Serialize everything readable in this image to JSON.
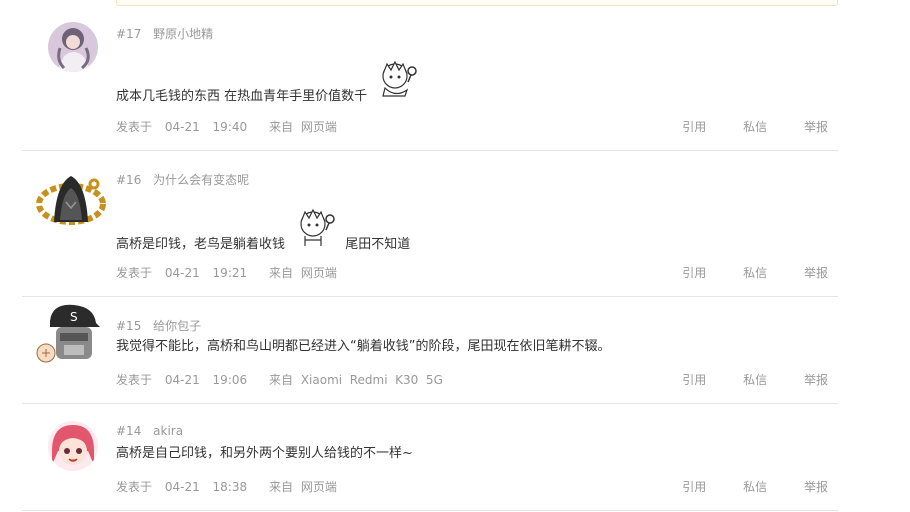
{
  "posts": [
    {
      "floor": "#17",
      "username": "野原小地精",
      "content_before": "成本几毛钱的东西  在热血青年手里价值数千",
      "content_after": "",
      "has_emote": true,
      "posted_label": "发表于",
      "date": "04-21",
      "time": "19:40",
      "source_label": "来自",
      "source": "网页端",
      "actions": [
        "引用",
        "私信",
        "举报"
      ],
      "avatar_icon": "anime-girl-avatar"
    },
    {
      "floor": "#16",
      "username": "为什么会有变态呢",
      "content_before": "高桥是印钱，老鸟是躺着收钱",
      "content_after": "尾田不知道",
      "has_emote": true,
      "posted_label": "发表于",
      "date": "04-21",
      "time": "19:21",
      "source_label": "来自",
      "source": "网页端",
      "actions": [
        "引用",
        "私信",
        "举报"
      ],
      "avatar_icon": "hooded-assassin-avatar"
    },
    {
      "floor": "#15",
      "username": "给你包子",
      "content_before": "我觉得不能比，高桥和鸟山明都已经进入“躺着收钱”的阶段，尾田现在依旧笔耕不辍。",
      "content_after": "",
      "has_emote": false,
      "posted_label": "发表于",
      "date": "04-21",
      "time": "19:06",
      "source_label": "来自",
      "source": "Xiaomi  Redmi  K30  5G",
      "actions": [
        "引用",
        "私信",
        "举报"
      ],
      "avatar_icon": "robot-cap-avatar"
    },
    {
      "floor": "#14",
      "username": "akira",
      "content_before": "高桥是自己印钱，和另外两个要别人给钱的不一样~",
      "content_after": "",
      "has_emote": false,
      "posted_label": "发表于",
      "date": "04-21",
      "time": "18:38",
      "source_label": "来自",
      "source": "网页端",
      "actions": [
        "引用",
        "私信",
        "举报"
      ],
      "avatar_icon": "pink-hair-girl-avatar"
    }
  ]
}
